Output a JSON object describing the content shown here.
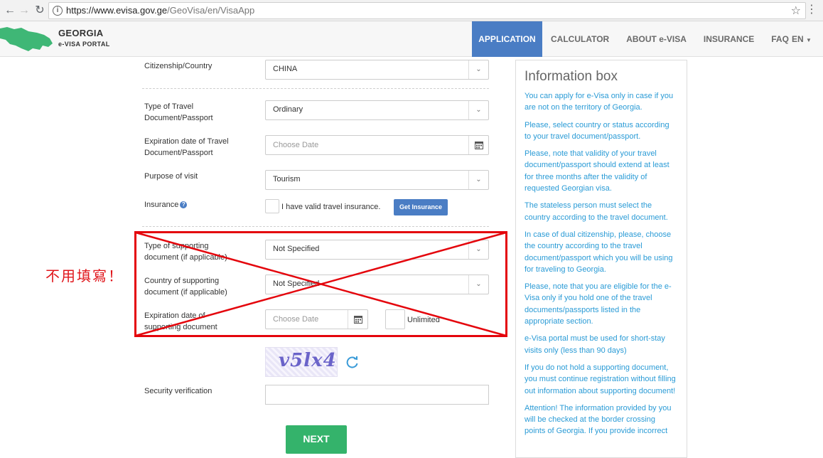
{
  "browser": {
    "url_prefix": "https://www.evisa.gov.ge",
    "url_path": "/GeoVisa/en/VisaApp"
  },
  "header": {
    "title": "GEORGIA",
    "subtitle": "e-VISA PORTAL",
    "menu": [
      "APPLICATION",
      "CALCULATOR",
      "ABOUT e-VISA",
      "INSURANCE",
      "FAQ"
    ],
    "lang": "EN"
  },
  "form": {
    "citizenship_label": "Citizenship/Country",
    "citizenship_value": "CHINA",
    "travel_doc_label": "Type of Travel Document/Passport",
    "travel_doc_value": "Ordinary",
    "expiration_label": "Expiration date of Travel Document/Passport",
    "expiration_placeholder": "Choose Date",
    "purpose_label": "Purpose of visit",
    "purpose_value": "Tourism",
    "insurance_label": "Insurance",
    "insurance_checkbox": "I have valid travel insurance.",
    "insurance_button": "Get Insurance",
    "supporting_type_label": "Type of supporting document (if applicable)",
    "supporting_type_value": "Not Specified",
    "supporting_country_label": "Country of supporting document (if applicable)",
    "supporting_country_value": "Not Specified",
    "supporting_exp_label": "Expiration date of supporting document",
    "supporting_exp_placeholder": "Choose Date",
    "unlimited_label": "Unlimited",
    "captcha_text": "v5lx4",
    "security_label": "Security verification",
    "next_button": "NEXT"
  },
  "annotation": {
    "note": "不用填寫！",
    "color": "#e4050c"
  },
  "info_box": {
    "title": "Information box",
    "paragraphs": [
      "You can apply for e-Visa only in case if you are not on the territory of Georgia.",
      "Please, select country or status according to your travel document/passport.",
      "Please, note that validity of your travel document/passport should extend at least for three months after the validity of requested Georgian visa.",
      "The stateless person must select the country according to the travel document.",
      "In case of dual citizenship, please, choose the country according to the travel document/passport which you will be using for traveling to Georgia.",
      "Please, note that you are eligible for the e-Visa only if you hold one of the travel documents/passports listed in the appropriate section.",
      "e-Visa portal must be used for short-stay visits only (less than 90 days)",
      "If you do not hold a supporting document, you must continue registration without filling out information about supporting document!",
      "Attention! The information provided by you will be checked at the border crossing points of Georgia. If you provide incorrect"
    ]
  },
  "colors": {
    "accent": "#4a7dc4",
    "next": "#34b36b",
    "info_text": "#2a9bd6"
  }
}
